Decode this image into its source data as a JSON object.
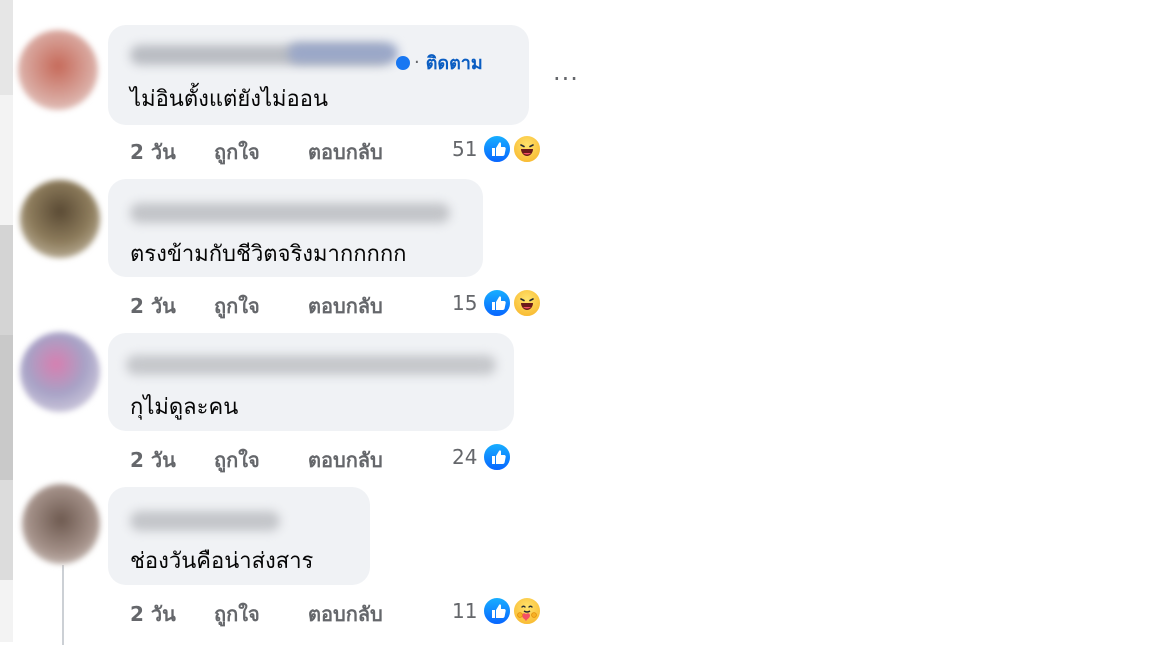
{
  "comments": [
    {
      "text": "ไม่อินตั้งแต่ยังไม่ออน",
      "follow_label": "ติดตาม",
      "time": "2 วัน",
      "like_label": "ถูกใจ",
      "reply_label": "ตอบกลับ",
      "reaction_count": "51",
      "reactions": [
        "like-icon",
        "haha-icon"
      ],
      "more_label": "...",
      "avatar_color": "#c77060"
    },
    {
      "text": "ตรงข้ามกับชีวิตจริงมากกกกก",
      "time": "2 วัน",
      "like_label": "ถูกใจ",
      "reply_label": "ตอบกลับ",
      "reaction_count": "15",
      "reactions": [
        "like-icon",
        "haha-icon"
      ],
      "avatar_color": "#6b5a3e"
    },
    {
      "text": "กุไม่ดูละคน",
      "time": "2 วัน",
      "like_label": "ถูกใจ",
      "reply_label": "ตอบกลับ",
      "reaction_count": "24",
      "reactions": [
        "like-icon"
      ],
      "avatar_color": "#c9a4c9"
    },
    {
      "text": "ช่องวันคือน่าส่งสาร",
      "time": "2 วัน",
      "like_label": "ถูกใจ",
      "reply_label": "ตอบกลับ",
      "reaction_count": "11",
      "reactions": [
        "like-icon",
        "care-icon"
      ],
      "avatar_color": "#7a6458"
    }
  ],
  "colors": {
    "link_blue": "#0a5dc2",
    "meta_gray": "#65676b",
    "bubble_bg": "#f0f2f5",
    "like_blue": "#0866ff"
  }
}
